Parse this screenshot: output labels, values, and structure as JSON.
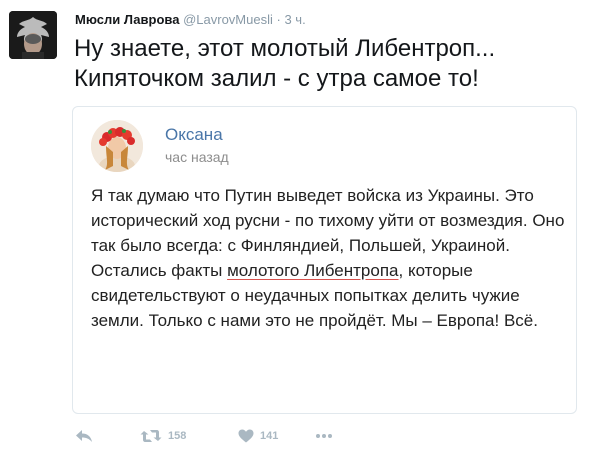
{
  "tweet": {
    "author_name": "Мюсли Лаврова",
    "author_handle": "@LavrovMuesli",
    "separator": "·",
    "time": "3 ч.",
    "text_line_1": "Ну знаете, этот молотый Либентроп...",
    "text_line_2": "Кипяточком залил - с утра самое то!"
  },
  "quote": {
    "name": "Оксана",
    "time": "час назад",
    "text_before": "Я так думаю что Путин выведет войска из Украины. Это исторический ход русни - по тихому уйти от возмездия. Оно так было всегда: с Финляндией, Польшей, Украиной. Остались факты ",
    "text_underlined": "молотого Либентропа",
    "text_after": ", которые свидетельствуют о неудачных попытках делить чужие земли. Только с нами это не пройдёт. Мы – Европа! Всё."
  },
  "actions": {
    "retweet_count": "158",
    "like_count": "141"
  },
  "colors": {
    "name_link": "#4a76a8",
    "muted": "#8899a6",
    "action_icon": "#aab8c2",
    "underline": "#d9534f"
  },
  "icons": [
    "reply-icon",
    "retweet-icon",
    "heart-icon",
    "more-icon"
  ]
}
